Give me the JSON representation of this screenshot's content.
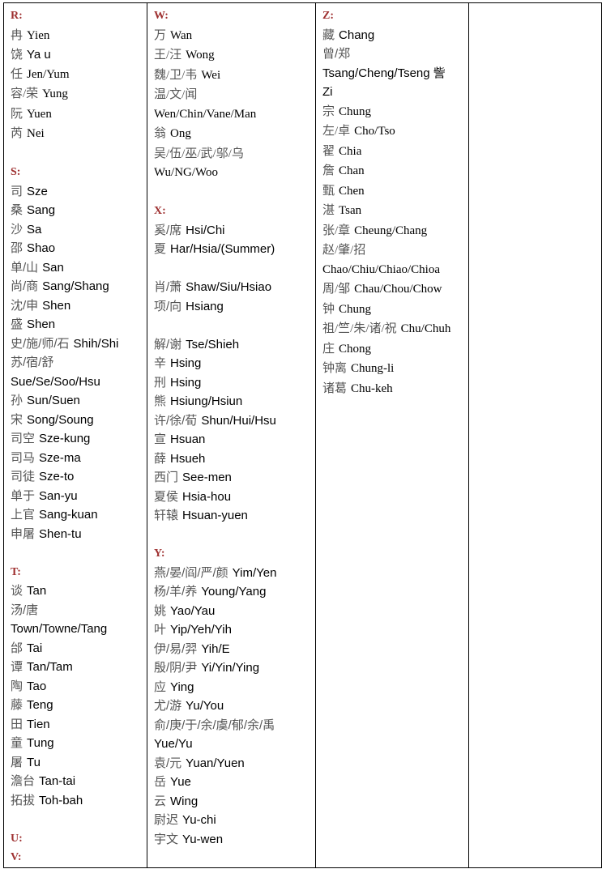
{
  "document": {
    "title": "Chinese Surname Romanization Table",
    "heading_color": "#9e3030",
    "hanzi_color": "#555555",
    "roman_color": "#000000",
    "border_color": "#000000",
    "columns": 4
  },
  "columns": [
    {
      "id": "column-1",
      "sections": [
        {
          "letter": "R:",
          "font": "serif",
          "entries": [
            {
              "han": "冉",
              "rom": "Yien",
              "font": "serif"
            },
            {
              "han": "饶",
              "rom": "Ya u",
              "font": "sans"
            },
            {
              "han": "任",
              "rom": "Jen/Yum",
              "font": "serif"
            },
            {
              "han": "容/荣",
              "rom": "Yung",
              "font": "serif"
            },
            {
              "han": "阮",
              "rom": "Yuen",
              "font": "serif"
            },
            {
              "han": "芮",
              "rom": "Nei",
              "font": "serif"
            }
          ]
        },
        {
          "letter": "S:",
          "font": "serif",
          "entries": [
            {
              "han": "司",
              "rom": "Sze",
              "font": "sans"
            },
            {
              "han": "桑",
              "rom": "Sang",
              "font": "sans"
            },
            {
              "han": "沙",
              "rom": "Sa",
              "font": "sans"
            },
            {
              "han": "邵",
              "rom": "Shao",
              "font": "sans"
            },
            {
              "han": "单/山",
              "rom": "San",
              "font": "sans"
            },
            {
              "han": "尚/商",
              "rom": "Sang/Shang",
              "font": "sans"
            },
            {
              "han": "沈/申",
              "rom": "Shen",
              "font": "sans"
            },
            {
              "han": "盛",
              "rom": "Shen",
              "font": "sans"
            },
            {
              "han": "史/施/师/石",
              "rom": "Shih/Shi",
              "font": "sans"
            },
            {
              "han": "苏/宿/舒",
              "rom": "Sue/Se/Soo/Hsu",
              "font": "sans",
              "stacked": true
            },
            {
              "han": "孙",
              "rom": "Sun/Suen",
              "font": "sans"
            },
            {
              "han": "宋",
              "rom": "Song/Soung",
              "font": "sans"
            },
            {
              "han": "司空",
              "rom": "Sze-kung",
              "font": "sans"
            },
            {
              "han": "司马",
              "rom": "Sze-ma",
              "font": "sans"
            },
            {
              "han": "司徒",
              "rom": "Sze-to",
              "font": "sans"
            },
            {
              "han": "单于",
              "rom": "San-yu",
              "font": "sans"
            },
            {
              "han": "上官",
              "rom": "Sang-kuan",
              "font": "sans"
            },
            {
              "han": "申屠",
              "rom": "Shen-tu",
              "font": "sans"
            }
          ]
        },
        {
          "letter": "T:",
          "font": "serif",
          "entries": [
            {
              "han": "谈",
              "rom": "Tan",
              "font": "sans"
            },
            {
              "han": "汤/唐",
              "rom": "Town/Towne/Tang",
              "font": "sans",
              "stacked": true
            },
            {
              "han": "邰",
              "rom": "Tai",
              "font": "sans"
            },
            {
              "han": "谭",
              "rom": "Tan/Tam",
              "font": "sans"
            },
            {
              "han": "陶",
              "rom": "Tao",
              "font": "sans"
            },
            {
              "han": "藤",
              "rom": "Teng",
              "font": "sans"
            },
            {
              "han": "田",
              "rom": "Tien",
              "font": "sans"
            },
            {
              "han": "童",
              "rom": "Tung",
              "font": "sans"
            },
            {
              "han": "屠",
              "rom": "Tu",
              "font": "sans"
            },
            {
              "han": "澹台",
              "rom": "Tan-tai",
              "font": "sans"
            },
            {
              "han": "拓拔",
              "rom": "Toh-bah",
              "font": "sans"
            }
          ]
        },
        {
          "letter": "U:",
          "font": "serif",
          "entries": []
        },
        {
          "letter": "V:",
          "font": "serif",
          "entries": [],
          "no_gap_before": true
        }
      ]
    },
    {
      "id": "column-2",
      "sections": [
        {
          "letter": "W:",
          "font": "serif",
          "entries": [
            {
              "han": "万",
              "rom": "Wan",
              "font": "serif"
            },
            {
              "han": "王/汪",
              "rom": "Wong",
              "font": "serif"
            },
            {
              "han": "魏/卫/韦",
              "rom": "Wei",
              "font": "serif"
            },
            {
              "han": "温/文/闻",
              "rom": "Wen/Chin/Vane/Man",
              "font": "serif",
              "stacked": true
            },
            {
              "han": "翁",
              "rom": "Ong",
              "font": "serif"
            },
            {
              "han": "吴/伍/巫/武/邬/乌",
              "rom": "Wu/NG/Woo",
              "font": "serif",
              "stacked": true
            }
          ]
        },
        {
          "letter": "X:",
          "font": "serif",
          "entries": [
            {
              "han": "奚/席",
              "rom": "Hsi/Chi",
              "font": "sans"
            },
            {
              "han": "夏",
              "rom": "Har/Hsia/(Summer)",
              "font": "sans"
            },
            {
              "blank": true
            },
            {
              "han": "肖/萧",
              "rom": "Shaw/Siu/Hsiao",
              "font": "sans"
            },
            {
              "han": "项/向",
              "rom": "Hsiang",
              "font": "sans"
            },
            {
              "blank": true
            },
            {
              "han": "解/谢",
              "rom": "Tse/Shieh",
              "font": "sans"
            },
            {
              "han": "辛",
              "rom": "Hsing",
              "font": "sans"
            },
            {
              "han": "刑",
              "rom": "Hsing",
              "font": "sans"
            },
            {
              "han": "熊",
              "rom": "Hsiung/Hsiun",
              "font": "sans"
            },
            {
              "han": "许/徐/荀",
              "rom": "Shun/Hui/Hsu",
              "font": "sans"
            },
            {
              "han": "宣",
              "rom": "Hsuan",
              "font": "sans"
            },
            {
              "han": "薛",
              "rom": "Hsueh",
              "font": "sans"
            },
            {
              "han": "西门",
              "rom": "See-men",
              "font": "sans"
            },
            {
              "han": "夏侯",
              "rom": "Hsia-hou",
              "font": "sans"
            },
            {
              "han": "轩辕",
              "rom": "Hsuan-yuen",
              "font": "sans"
            }
          ]
        },
        {
          "letter": "Y:",
          "font": "serif",
          "entries": [
            {
              "han": "燕/晏/阎/严/颜",
              "rom": "Yim/Yen",
              "font": "sans"
            },
            {
              "han": "杨/羊/养",
              "rom": "Young/Yang",
              "font": "sans"
            },
            {
              "han": "姚",
              "rom": "Yao/Yau",
              "font": "sans"
            },
            {
              "han": "叶",
              "rom": "Yip/Yeh/Yih",
              "font": "sans"
            },
            {
              "han": "伊/易/羿",
              "rom": "Yih/E",
              "font": "sans"
            },
            {
              "han": "殷/阴/尹",
              "rom": "Yi/Yin/Ying",
              "font": "sans"
            },
            {
              "han": "应",
              "rom": "Ying",
              "font": "sans"
            },
            {
              "han": "尤/游",
              "rom": "Yu/You",
              "font": "sans"
            },
            {
              "han": "俞/庚/于/余/虞/郁/余/禹",
              "rom": "Yue/Yu",
              "font": "sans",
              "stacked": true
            },
            {
              "han": "袁/元",
              "rom": "Yuan/Yuen",
              "font": "sans"
            },
            {
              "han": "岳",
              "rom": "Yue",
              "font": "sans"
            },
            {
              "han": "云",
              "rom": "Wing",
              "font": "sans"
            },
            {
              "han": "尉迟",
              "rom": "Yu-chi",
              "font": "sans"
            },
            {
              "han": "宇文",
              "rom": "Yu-wen",
              "font": "sans"
            }
          ]
        }
      ]
    },
    {
      "id": "column-3",
      "sections": [
        {
          "letter": "Z:",
          "font": "serif",
          "entries": [
            {
              "han": "藏",
              "rom": "Chang",
              "font": "sans"
            },
            {
              "han": "曾/郑",
              "rom": "Tsang/Cheng/Tseng 訾",
              "font": "sans",
              "stacked": true,
              "rom2": "Zi"
            },
            {
              "han": "宗",
              "rom": "Chung",
              "font": "serif"
            },
            {
              "han": "左/卓",
              "rom": "Cho/Tso",
              "font": "serif"
            },
            {
              "han": "翟",
              "rom": "Chia",
              "font": "serif"
            },
            {
              "han": "詹",
              "rom": "Chan",
              "font": "serif"
            },
            {
              "han": "甄",
              "rom": "Chen",
              "font": "serif"
            },
            {
              "han": "湛",
              "rom": "Tsan",
              "font": "serif"
            },
            {
              "han": "张/章",
              "rom": "Cheung/Chang",
              "font": "serif"
            },
            {
              "han": "赵/肇/招",
              "rom": "Chao/Chiu/Chiao/Chioa",
              "font": "serif",
              "stacked": true
            },
            {
              "han": "周/邹",
              "rom": "Chau/Chou/Chow",
              "font": "serif"
            },
            {
              "han": "钟",
              "rom": "Chung",
              "font": "serif"
            },
            {
              "han": "祖/竺/朱/诸/祝",
              "rom": "Chu/Chuh",
              "font": "serif"
            },
            {
              "han": "庄",
              "rom": "Chong",
              "font": "serif"
            },
            {
              "han": "钟离",
              "rom": "Chung-li",
              "font": "serif"
            },
            {
              "han": "诸葛",
              "rom": "Chu-keh",
              "font": "serif"
            }
          ]
        }
      ]
    },
    {
      "id": "column-4",
      "sections": []
    }
  ]
}
